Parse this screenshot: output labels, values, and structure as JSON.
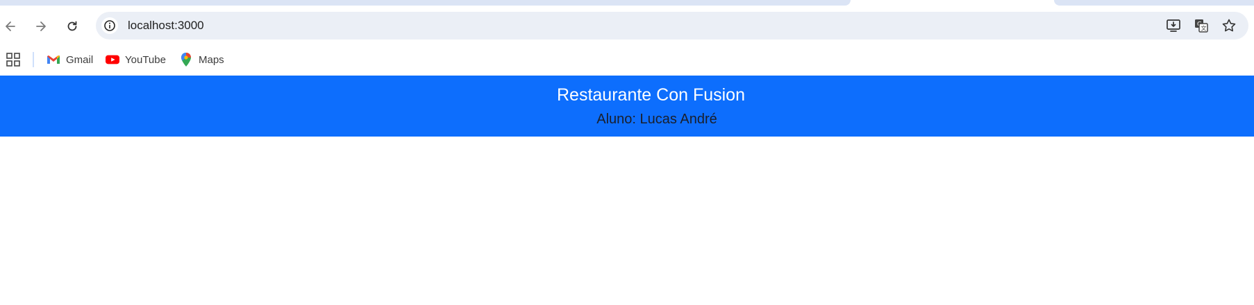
{
  "browser": {
    "url": "localhost:3000",
    "toolbar_icons": [
      "back-arrow-icon",
      "forward-arrow-icon",
      "reload-icon",
      "site-info-icon",
      "install-app-icon",
      "translate-icon",
      "bookmark-star-icon"
    ],
    "bookmarks": [
      {
        "label": "Gmail",
        "icon": "gmail-icon"
      },
      {
        "label": "YouTube",
        "icon": "youtube-icon"
      },
      {
        "label": "Maps",
        "icon": "maps-icon"
      }
    ]
  },
  "page": {
    "header": {
      "title": "Restaurante Con Fusion",
      "subtitle": "Aluno: Lucas André",
      "background": "#0d6efd"
    }
  }
}
